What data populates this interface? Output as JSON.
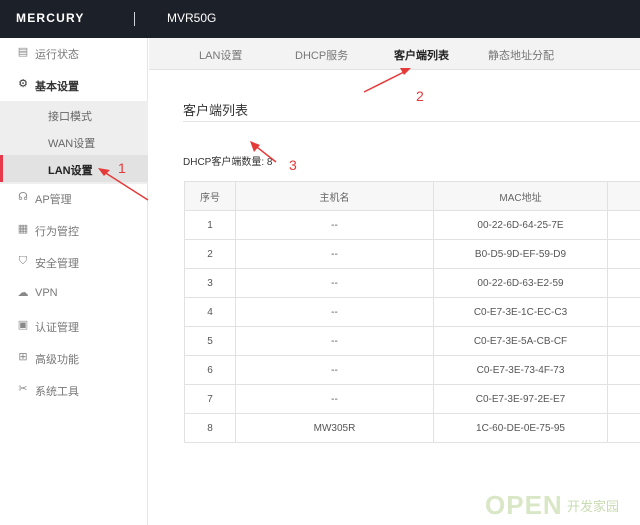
{
  "header": {
    "brand": "MERCURY",
    "model": "MVR50G"
  },
  "sidebar": {
    "items": [
      {
        "label": "运行状态",
        "icon": "status-icon"
      },
      {
        "label": "基本设置",
        "icon": "gear-icon"
      },
      {
        "label": "AP管理",
        "icon": "ap-icon"
      },
      {
        "label": "行为管控",
        "icon": "behavior-icon"
      },
      {
        "label": "安全管理",
        "icon": "shield-icon"
      },
      {
        "label": "VPN",
        "icon": "vpn-icon"
      },
      {
        "label": "认证管理",
        "icon": "auth-icon"
      },
      {
        "label": "高级功能",
        "icon": "advanced-icon"
      },
      {
        "label": "系统工具",
        "icon": "tools-icon"
      }
    ],
    "sub_items": [
      {
        "label": "接口模式"
      },
      {
        "label": "WAN设置"
      },
      {
        "label": "LAN设置"
      }
    ]
  },
  "tabs": [
    {
      "label": "LAN设置"
    },
    {
      "label": "DHCP服务"
    },
    {
      "label": "客户端列表"
    },
    {
      "label": "静态地址分配"
    }
  ],
  "main": {
    "section_title": "客户端列表",
    "count_label": "DHCP客户端数量:",
    "count_value": "8"
  },
  "table": {
    "headers": [
      "序号",
      "主机名",
      "MAC地址"
    ],
    "rows": [
      [
        "1",
        "--",
        "00-22-6D-64-25-7E"
      ],
      [
        "2",
        "--",
        "B0-D5-9D-EF-59-D9"
      ],
      [
        "3",
        "--",
        "00-22-6D-63-E2-59"
      ],
      [
        "4",
        "--",
        "C0-E7-3E-1C-EC-C3"
      ],
      [
        "5",
        "--",
        "C0-E7-3E-5A-CB-CF"
      ],
      [
        "6",
        "--",
        "C0-E7-3E-73-4F-73"
      ],
      [
        "7",
        "--",
        "C0-E7-3E-97-2E-E7"
      ],
      [
        "8",
        "MW305R",
        "1C-60-DE-0E-75-95"
      ]
    ]
  },
  "annotations": [
    "1",
    "2",
    "3"
  ],
  "watermark": {
    "main": "OPEN",
    "sub": "开发家园"
  },
  "colors": {
    "topbar": "#1c2028",
    "accent": "#e8394b",
    "annotation": "#e53a3a"
  }
}
